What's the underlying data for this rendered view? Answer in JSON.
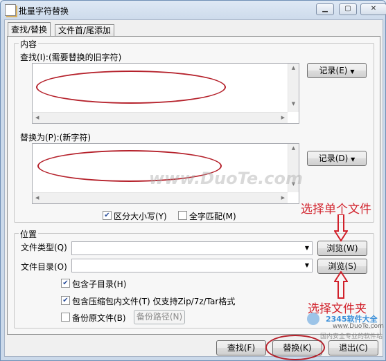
{
  "window": {
    "title": "批量字符替换"
  },
  "tabs": [
    {
      "label": "查找/替换",
      "active": true
    },
    {
      "label": "文件首/尾添加",
      "active": false
    }
  ],
  "content_group": {
    "legend": "内容",
    "find_label": "查找(I):(需要替换的旧字符)",
    "find_history_button": "记录(E)",
    "replace_label": "替换为(P):(新字符)",
    "replace_history_button": "记录(D)",
    "case_sensitive": {
      "label": "区分大小写(Y)",
      "checked": true
    },
    "whole_match": {
      "label": "全字匹配(M)",
      "checked": false
    }
  },
  "location_group": {
    "legend": "位置",
    "file_type_label": "文件类型(Q)",
    "file_type_browse": "浏览(W)",
    "file_dir_label": "文件目录(O)",
    "file_dir_browse": "浏览(S)",
    "include_subdirs": {
      "label": "包含子目录(H)",
      "checked": true
    },
    "include_archives": {
      "label": "包含压缩包内文件(T) 仅支持Zip/7z/Tar格式",
      "checked": true
    },
    "backup_original": {
      "label": "备份原文件(B)",
      "checked": false
    },
    "backup_path_button": "备份路径(N)"
  },
  "footer": {
    "find_button": "查找(F)",
    "replace_button": "替换(K)",
    "exit_button": "退出(C)"
  },
  "annotations": {
    "select_single_file": "选择单个文件",
    "select_folder": "选择文件夹"
  },
  "watermarks": {
    "center": "www.DuoTe.com",
    "corner_brand": "2345软件大全",
    "corner_url": "www.DuoTe.com",
    "corner_slogan": "国内安全专业的软件站"
  },
  "colors": {
    "annotation_red": "#d1202a",
    "oval_red": "#b5212b"
  }
}
